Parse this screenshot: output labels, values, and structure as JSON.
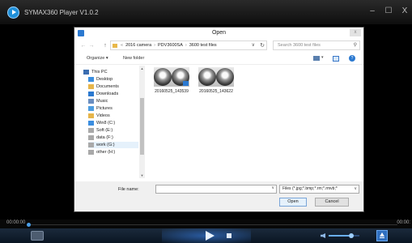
{
  "app": {
    "title": "SYMAX360 Player V1.0.2"
  },
  "window_controls": {
    "minimize": "–",
    "maximize": "☐",
    "close": "X"
  },
  "timeline": {
    "current_time": "00:00:00",
    "end_time": "00:00:"
  },
  "dialog": {
    "title": "Open",
    "close": "x",
    "nav": {
      "back": "←",
      "forward": "→",
      "up": "↑"
    },
    "path": {
      "overflow": "«",
      "crumbs": [
        "2016 camera",
        "PDV3600SA",
        "3600 test files"
      ],
      "separator": "›"
    },
    "search_placeholder": "Search 3600 test files",
    "toolbar": {
      "organize": "Organize ▾",
      "new_folder": "New folder",
      "help": "?"
    },
    "nav_pane": [
      {
        "label": "This PC",
        "icon": "pc-icon",
        "color": "#3b6db0"
      },
      {
        "label": "Desktop",
        "icon": "desktop-icon",
        "color": "#3b8ee0"
      },
      {
        "label": "Documents",
        "icon": "documents-icon",
        "color": "#e6b54a"
      },
      {
        "label": "Downloads",
        "icon": "downloads-icon",
        "color": "#2b79d0"
      },
      {
        "label": "Music",
        "icon": "music-icon",
        "color": "#6a8ec0"
      },
      {
        "label": "Pictures",
        "icon": "pictures-icon",
        "color": "#4d9de0"
      },
      {
        "label": "Videos",
        "icon": "videos-icon",
        "color": "#e6b54a"
      },
      {
        "label": "Win8 (C:)",
        "icon": "drive-windows-icon",
        "color": "#3b8ee0"
      },
      {
        "label": "Soft (E:)",
        "icon": "drive-icon",
        "color": "#a9a9a9"
      },
      {
        "label": "data (F:)",
        "icon": "drive-icon",
        "color": "#a9a9a9"
      },
      {
        "label": "work (G:)",
        "icon": "drive-icon",
        "color": "#a9a9a9"
      },
      {
        "label": "other (H:)",
        "icon": "drive-icon",
        "color": "#a9a9a9"
      }
    ],
    "files": [
      {
        "name": "20160525_143539"
      },
      {
        "name": "20160525_143622"
      }
    ],
    "footer": {
      "file_name_label": "File name:",
      "file_name_value": "",
      "filter": "Files (*.jpg;*.bmp;*.rm;*.rmvb;*",
      "open": "Open",
      "cancel": "Cancel"
    }
  },
  "colors": {
    "accent": "#2b79d0",
    "player_glow": "#3c8cff"
  }
}
